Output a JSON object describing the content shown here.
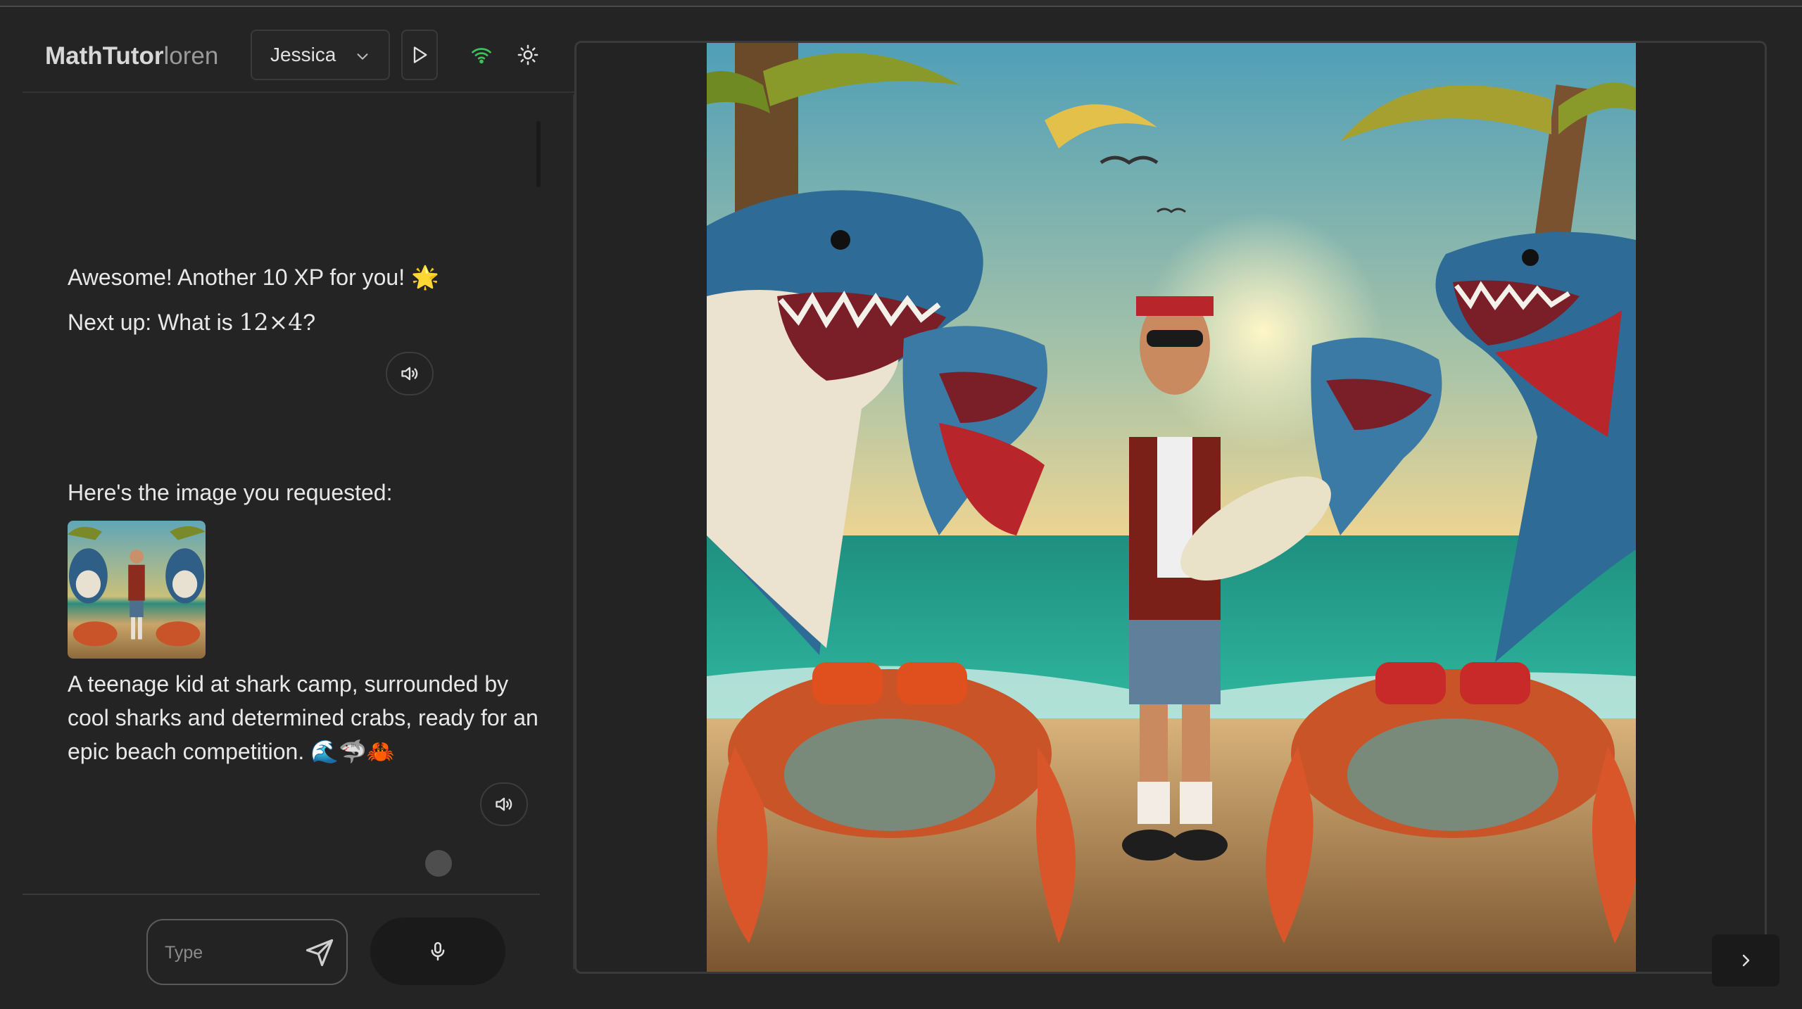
{
  "header": {
    "brand_main": "MathTutor",
    "brand_sub": "loren",
    "user_selected": "Jessica",
    "icons": [
      "play-icon",
      "wifi-icon",
      "brightness-icon",
      "mute-icon"
    ]
  },
  "chat": {
    "messages": [
      {
        "line1": "Awesome! Another 10 XP for you! 🌟",
        "line2_prefix": "Next up: What is ",
        "math": "12×4",
        "line2_suffix": "?"
      },
      {
        "intro": "Here's the image you requested:",
        "caption": "A teenage kid at shark camp, surrounded by cool sharks and determined crabs, ready for an epic beach competition. 🌊🦈🦀"
      }
    ]
  },
  "composer": {
    "placeholder": "Type"
  },
  "colors": {
    "background": "#242424",
    "wifi_green": "#3fbf5a",
    "panel_border": "#3a3a3a"
  }
}
